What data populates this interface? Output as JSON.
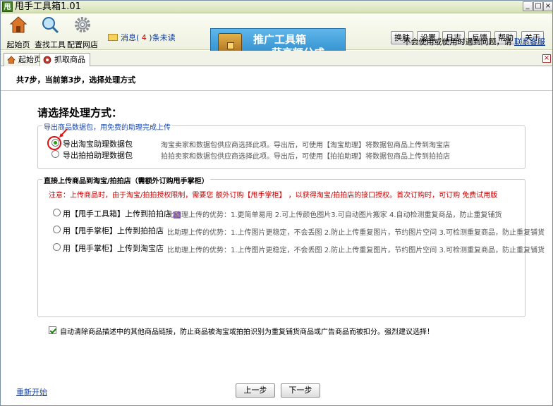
{
  "window": {
    "title": "甩手工具箱1.01",
    "app_icon_glyph": "甩"
  },
  "toolbar": {
    "tools": [
      {
        "label": "起始页",
        "icon": "home-icon"
      },
      {
        "label": "查找工具",
        "icon": "magnifier-icon"
      },
      {
        "label": "配置网店",
        "icon": "gear-icon"
      }
    ],
    "message": {
      "prefix": "消息(",
      "count": "4",
      "suffix": ")条未读"
    },
    "banner": {
      "line1": "推广工具箱",
      "line2": "获高额分成"
    },
    "buttons": [
      "换肤",
      "设置",
      "日志",
      "反馈",
      "帮助",
      "关于"
    ],
    "help_text": "不会使用或使用时遇到问题，请",
    "help_link": "联系客服"
  },
  "tabs": [
    {
      "label": "起始页",
      "icon": "home-icon"
    },
    {
      "label": "抓取商品",
      "icon": "capture-icon"
    }
  ],
  "step": {
    "text": "共7步，当前第3步，选择处理方式"
  },
  "main": {
    "heading": "请选择处理方式：",
    "group1": {
      "legend": "导出商品数据包，用免费的助理完成上传",
      "options": [
        {
          "label": "导出淘宝助理数据包",
          "checked": true,
          "desc": "淘宝卖家和数据包供应商选择此项。导出后，可使用【淘宝助理】将数据包商品上传到淘宝店"
        },
        {
          "label": "导出拍拍助理数据包",
          "checked": false,
          "desc": "拍拍卖家和数据包供应商选择此项。导出后，可使用【拍拍助理】将数据包商品上传到拍拍店"
        }
      ]
    },
    "group2": {
      "legend": "直接上传商品到淘宝/拍拍店（需额外订购甩手掌柜）",
      "note_a": "注意：上传商品时，由于淘宝/拍拍授权限制，需要您",
      "note_b": "额外订购【甩手掌柜】",
      "note_c": "，以获得淘宝/拍拍店的接口授权。首次订购时，可订购",
      "note_d": "免费试用版",
      "options": [
        {
          "label": "用【甩手工具箱】上传到拍拍店",
          "badge": "荐",
          "desc": "比助理上传的优势：1.更简单易用 2.可上传颜色图片3.可自动图片搬家 4.自动检测重复商品，防止重复铺货"
        },
        {
          "label": "用【甩手掌柜】上传到拍拍店",
          "desc": "比助理上传的优势：1.上传图片更稳定，不会丢图 2.防止上传重复图片，节约图片空间 3.可检测重复商品，防止重复铺货"
        },
        {
          "label": "用【甩手掌柜】上传到淘宝店",
          "desc": "比助理上传的优势：1.上传图片更稳定，不会丢图 2.防止上传重复图片，节约图片空间 3.可检测重复商品，防止重复铺货"
        }
      ]
    },
    "checkbox_label": "自动清除商品描述中的其他商品链接，防止商品被淘宝或拍拍识别为重复铺货商品或广告商品而被扣分。强烈建议选择！",
    "checkbox_checked": true
  },
  "footer": {
    "restart": "重新开始",
    "prev": "上一步",
    "next": "下一步"
  },
  "colors": {
    "accent_red": "#e01010",
    "link_blue": "#1b47a8",
    "banner_blue": "#2a88c9"
  }
}
